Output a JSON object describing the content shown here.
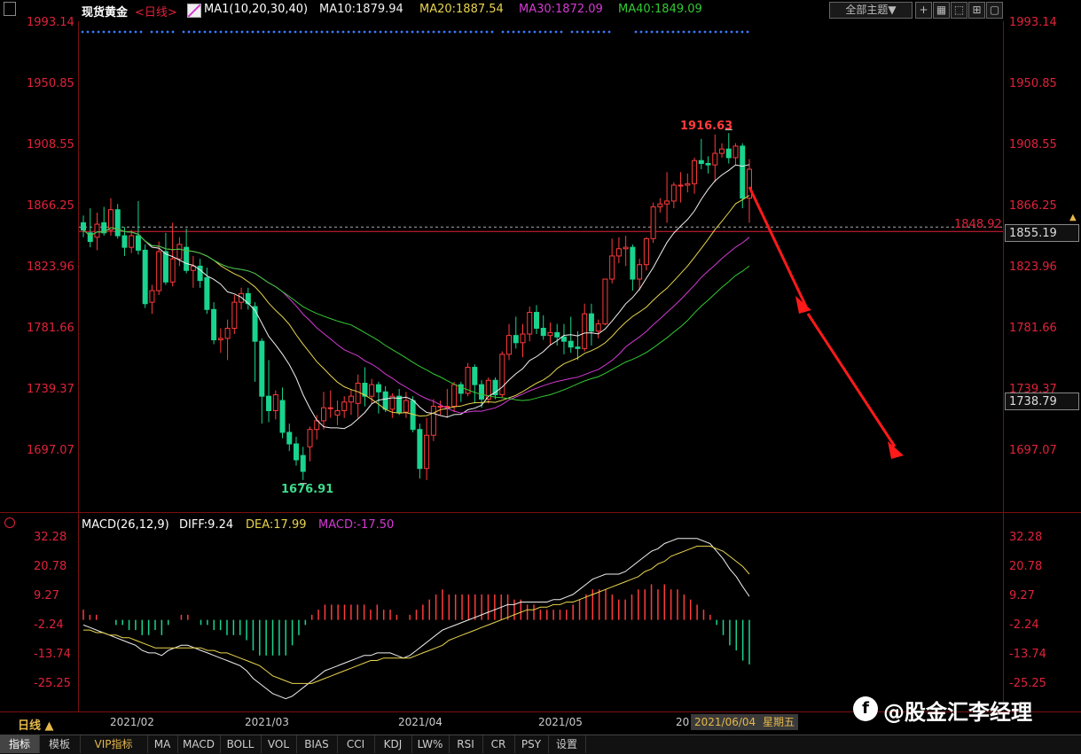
{
  "header": {
    "symbol": "现货黄金",
    "period": "<日线>",
    "ma_label": "MA1(10,20,30,40)",
    "ma10": "MA10:1879.94",
    "ma20": "MA20:1887.54",
    "ma30": "MA30:1872.09",
    "ma40": "MA40:1849.09",
    "theme_button": "全部主题▼"
  },
  "colors": {
    "up": "#ff3b3b",
    "down": "#19d48f",
    "ma10": "#f0f0f0",
    "ma20": "#e8d44d",
    "ma30": "#d43ad4",
    "ma40": "#34c934",
    "axis": "#e0223a",
    "arrow": "#ff1a1a"
  },
  "price_axis": {
    "labels": [
      "1993.14",
      "1950.85",
      "1908.55",
      "1866.25",
      "1823.96",
      "1781.66",
      "1739.37",
      "1697.07"
    ]
  },
  "price_annotations": {
    "high": "1916.63",
    "low": "1676.91",
    "current_line": "1848.92",
    "cursor_price": "1855.19",
    "cursor_price_low": "1738.79"
  },
  "macd": {
    "label": "MACD(26,12,9)",
    "diff": "DIFF:9.24",
    "dea": "DEA:17.99",
    "macd": "MACD:-17.50",
    "axis_labels": [
      "32.28",
      "20.78",
      "9.27",
      "-2.24",
      "-13.74",
      "-25.25"
    ]
  },
  "x_axis": {
    "labels": [
      "2021/02",
      "2021/03",
      "2021/04",
      "2021/05",
      "20"
    ],
    "cursor_date": "2021/06/04",
    "cursor_weekday": "星期五"
  },
  "bottom_tabs": {
    "period": "日线 ▲",
    "items": [
      "指标",
      "模板",
      "VIP指标",
      "MA",
      "MACD",
      "BOLL",
      "VOL",
      "BIAS",
      "CCI",
      "KDJ",
      "LW%",
      "RSI",
      "CR",
      "PSY",
      "设置"
    ]
  },
  "watermark": "@股金汇李经理",
  "chart_data": {
    "type": "candlestick",
    "title": "现货黄金<日线>",
    "ylim": [
      1665,
      2000
    ],
    "yticks": [
      1993.14,
      1950.85,
      1908.55,
      1866.25,
      1823.96,
      1781.66,
      1739.37,
      1697.07
    ],
    "x_range": [
      "2021-01-20",
      "2021-06-04"
    ],
    "candles": [
      {
        "date": "2021-01-20",
        "o": 1855,
        "h": 1860,
        "l": 1845,
        "c": 1850
      },
      {
        "date": "2021-01-21",
        "o": 1848,
        "h": 1865,
        "l": 1838,
        "c": 1842
      },
      {
        "date": "2021-01-22",
        "o": 1845,
        "h": 1862,
        "l": 1836,
        "c": 1854
      },
      {
        "date": "2021-01-25",
        "o": 1855,
        "h": 1866,
        "l": 1846,
        "c": 1848
      },
      {
        "date": "2021-01-26",
        "o": 1850,
        "h": 1872,
        "l": 1846,
        "c": 1864
      },
      {
        "date": "2021-01-27",
        "o": 1864,
        "h": 1868,
        "l": 1844,
        "c": 1846
      },
      {
        "date": "2021-01-28",
        "o": 1846,
        "h": 1852,
        "l": 1832,
        "c": 1838
      },
      {
        "date": "2021-01-29",
        "o": 1838,
        "h": 1850,
        "l": 1834,
        "c": 1846
      },
      {
        "date": "2021-02-01",
        "o": 1846,
        "h": 1870,
        "l": 1833,
        "c": 1836
      },
      {
        "date": "2021-02-02",
        "o": 1836,
        "h": 1840,
        "l": 1796,
        "c": 1799
      },
      {
        "date": "2021-02-03",
        "o": 1800,
        "h": 1812,
        "l": 1792,
        "c": 1808
      },
      {
        "date": "2021-02-04",
        "o": 1808,
        "h": 1842,
        "l": 1805,
        "c": 1835
      },
      {
        "date": "2021-02-05",
        "o": 1835,
        "h": 1848,
        "l": 1812,
        "c": 1814
      },
      {
        "date": "2021-02-08",
        "o": 1814,
        "h": 1855,
        "l": 1811,
        "c": 1830
      },
      {
        "date": "2021-02-09",
        "o": 1830,
        "h": 1845,
        "l": 1825,
        "c": 1840
      },
      {
        "date": "2021-02-10",
        "o": 1838,
        "h": 1851,
        "l": 1820,
        "c": 1822
      },
      {
        "date": "2021-02-11",
        "o": 1822,
        "h": 1832,
        "l": 1810,
        "c": 1825
      },
      {
        "date": "2021-02-12",
        "o": 1825,
        "h": 1830,
        "l": 1810,
        "c": 1815
      },
      {
        "date": "2021-02-15",
        "o": 1817,
        "h": 1824,
        "l": 1792,
        "c": 1795
      },
      {
        "date": "2021-02-16",
        "o": 1795,
        "h": 1800,
        "l": 1771,
        "c": 1774
      },
      {
        "date": "2021-02-17",
        "o": 1774,
        "h": 1782,
        "l": 1765,
        "c": 1775
      },
      {
        "date": "2021-02-18",
        "o": 1775,
        "h": 1788,
        "l": 1760,
        "c": 1782
      },
      {
        "date": "2021-02-19",
        "o": 1782,
        "h": 1805,
        "l": 1778,
        "c": 1800
      },
      {
        "date": "2021-02-22",
        "o": 1800,
        "h": 1810,
        "l": 1795,
        "c": 1806
      },
      {
        "date": "2021-02-23",
        "o": 1806,
        "h": 1810,
        "l": 1795,
        "c": 1799
      },
      {
        "date": "2021-02-24",
        "o": 1797,
        "h": 1800,
        "l": 1745,
        "c": 1773
      },
      {
        "date": "2021-02-25",
        "o": 1773,
        "h": 1775,
        "l": 1716,
        "c": 1735
      },
      {
        "date": "2021-02-26",
        "o": 1735,
        "h": 1760,
        "l": 1717,
        "c": 1725
      },
      {
        "date": "2021-03-01",
        "o": 1725,
        "h": 1739,
        "l": 1719,
        "c": 1736
      },
      {
        "date": "2021-03-02",
        "o": 1732,
        "h": 1741,
        "l": 1706,
        "c": 1710
      },
      {
        "date": "2021-03-03",
        "o": 1710,
        "h": 1716,
        "l": 1697,
        "c": 1702
      },
      {
        "date": "2021-03-04",
        "o": 1702,
        "h": 1707,
        "l": 1687,
        "c": 1691
      },
      {
        "date": "2021-03-05",
        "o": 1694,
        "h": 1700,
        "l": 1677,
        "c": 1683
      },
      {
        "date": "2021-03-08",
        "o": 1700,
        "h": 1714,
        "l": 1690,
        "c": 1712
      },
      {
        "date": "2021-03-09",
        "o": 1712,
        "h": 1722,
        "l": 1705,
        "c": 1718
      },
      {
        "date": "2021-03-10",
        "o": 1718,
        "h": 1738,
        "l": 1712,
        "c": 1727
      },
      {
        "date": "2021-03-11",
        "o": 1727,
        "h": 1739,
        "l": 1720,
        "c": 1727
      },
      {
        "date": "2021-03-12",
        "o": 1722,
        "h": 1732,
        "l": 1715,
        "c": 1725
      },
      {
        "date": "2021-03-15",
        "o": 1725,
        "h": 1735,
        "l": 1720,
        "c": 1731
      },
      {
        "date": "2021-03-16",
        "o": 1731,
        "h": 1740,
        "l": 1722,
        "c": 1735
      },
      {
        "date": "2021-03-17",
        "o": 1730,
        "h": 1750,
        "l": 1720,
        "c": 1744
      },
      {
        "date": "2021-03-18",
        "o": 1744,
        "h": 1755,
        "l": 1728,
        "c": 1735
      },
      {
        "date": "2021-03-19",
        "o": 1735,
        "h": 1747,
        "l": 1730,
        "c": 1743
      },
      {
        "date": "2021-03-22",
        "o": 1743,
        "h": 1745,
        "l": 1723,
        "c": 1738
      },
      {
        "date": "2021-03-23",
        "o": 1738,
        "h": 1742,
        "l": 1724,
        "c": 1726
      },
      {
        "date": "2021-03-24",
        "o": 1726,
        "h": 1737,
        "l": 1720,
        "c": 1735
      },
      {
        "date": "2021-03-25",
        "o": 1735,
        "h": 1740,
        "l": 1722,
        "c": 1724
      },
      {
        "date": "2021-03-26",
        "o": 1724,
        "h": 1738,
        "l": 1720,
        "c": 1732
      },
      {
        "date": "2021-03-29",
        "o": 1732,
        "h": 1735,
        "l": 1710,
        "c": 1712
      },
      {
        "date": "2021-03-30",
        "o": 1712,
        "h": 1716,
        "l": 1678,
        "c": 1685
      },
      {
        "date": "2021-03-31",
        "o": 1685,
        "h": 1720,
        "l": 1677,
        "c": 1708
      },
      {
        "date": "2021-04-01",
        "o": 1708,
        "h": 1733,
        "l": 1704,
        "c": 1728
      },
      {
        "date": "2021-04-02",
        "o": 1728,
        "h": 1732,
        "l": 1722,
        "c": 1728
      },
      {
        "date": "2021-04-05",
        "o": 1728,
        "h": 1740,
        "l": 1720,
        "c": 1728
      },
      {
        "date": "2021-04-06",
        "o": 1728,
        "h": 1745,
        "l": 1724,
        "c": 1743
      },
      {
        "date": "2021-04-07",
        "o": 1743,
        "h": 1745,
        "l": 1731,
        "c": 1737
      },
      {
        "date": "2021-04-08",
        "o": 1737,
        "h": 1758,
        "l": 1735,
        "c": 1755
      },
      {
        "date": "2021-04-09",
        "o": 1755,
        "h": 1757,
        "l": 1730,
        "c": 1743
      },
      {
        "date": "2021-04-12",
        "o": 1743,
        "h": 1746,
        "l": 1727,
        "c": 1733
      },
      {
        "date": "2021-04-13",
        "o": 1733,
        "h": 1748,
        "l": 1730,
        "c": 1746
      },
      {
        "date": "2021-04-14",
        "o": 1746,
        "h": 1748,
        "l": 1733,
        "c": 1736
      },
      {
        "date": "2021-04-15",
        "o": 1736,
        "h": 1766,
        "l": 1734,
        "c": 1764
      },
      {
        "date": "2021-04-16",
        "o": 1764,
        "h": 1785,
        "l": 1760,
        "c": 1777
      },
      {
        "date": "2021-04-19",
        "o": 1777,
        "h": 1790,
        "l": 1768,
        "c": 1772
      },
      {
        "date": "2021-04-20",
        "o": 1772,
        "h": 1785,
        "l": 1762,
        "c": 1778
      },
      {
        "date": "2021-04-21",
        "o": 1778,
        "h": 1797,
        "l": 1773,
        "c": 1793
      },
      {
        "date": "2021-04-22",
        "o": 1793,
        "h": 1798,
        "l": 1778,
        "c": 1782
      },
      {
        "date": "2021-04-23",
        "o": 1782,
        "h": 1791,
        "l": 1774,
        "c": 1777
      },
      {
        "date": "2021-04-26",
        "o": 1777,
        "h": 1786,
        "l": 1770,
        "c": 1779
      },
      {
        "date": "2021-04-27",
        "o": 1779,
        "h": 1785,
        "l": 1770,
        "c": 1776
      },
      {
        "date": "2021-04-28",
        "o": 1776,
        "h": 1785,
        "l": 1764,
        "c": 1773
      },
      {
        "date": "2021-04-29",
        "o": 1773,
        "h": 1790,
        "l": 1765,
        "c": 1769
      },
      {
        "date": "2021-04-30",
        "o": 1769,
        "h": 1780,
        "l": 1760,
        "c": 1768
      },
      {
        "date": "2021-05-03",
        "o": 1768,
        "h": 1799,
        "l": 1766,
        "c": 1792
      },
      {
        "date": "2021-05-04",
        "o": 1792,
        "h": 1799,
        "l": 1770,
        "c": 1780
      },
      {
        "date": "2021-05-05",
        "o": 1780,
        "h": 1788,
        "l": 1775,
        "c": 1785
      },
      {
        "date": "2021-05-06",
        "o": 1785,
        "h": 1816,
        "l": 1784,
        "c": 1816
      },
      {
        "date": "2021-05-07",
        "o": 1816,
        "h": 1844,
        "l": 1813,
        "c": 1832
      },
      {
        "date": "2021-05-10",
        "o": 1832,
        "h": 1845,
        "l": 1827,
        "c": 1837
      },
      {
        "date": "2021-05-11",
        "o": 1837,
        "h": 1846,
        "l": 1825,
        "c": 1838
      },
      {
        "date": "2021-05-12",
        "o": 1838,
        "h": 1840,
        "l": 1808,
        "c": 1816
      },
      {
        "date": "2021-05-13",
        "o": 1816,
        "h": 1830,
        "l": 1808,
        "c": 1826
      },
      {
        "date": "2021-05-14",
        "o": 1826,
        "h": 1845,
        "l": 1822,
        "c": 1844
      },
      {
        "date": "2021-05-17",
        "o": 1844,
        "h": 1869,
        "l": 1841,
        "c": 1866
      },
      {
        "date": "2021-05-18",
        "o": 1866,
        "h": 1872,
        "l": 1862,
        "c": 1868
      },
      {
        "date": "2021-05-19",
        "o": 1868,
        "h": 1890,
        "l": 1855,
        "c": 1870
      },
      {
        "date": "2021-05-20",
        "o": 1870,
        "h": 1883,
        "l": 1865,
        "c": 1881
      },
      {
        "date": "2021-05-21",
        "o": 1881,
        "h": 1890,
        "l": 1869,
        "c": 1881
      },
      {
        "date": "2021-05-24",
        "o": 1881,
        "h": 1889,
        "l": 1876,
        "c": 1882
      },
      {
        "date": "2021-05-25",
        "o": 1882,
        "h": 1900,
        "l": 1875,
        "c": 1898
      },
      {
        "date": "2021-05-26",
        "o": 1898,
        "h": 1913,
        "l": 1892,
        "c": 1896
      },
      {
        "date": "2021-05-27",
        "o": 1896,
        "h": 1901,
        "l": 1889,
        "c": 1895
      },
      {
        "date": "2021-05-28",
        "o": 1895,
        "h": 1916,
        "l": 1883,
        "c": 1903
      },
      {
        "date": "2021-05-31",
        "o": 1903,
        "h": 1910,
        "l": 1900,
        "c": 1906
      },
      {
        "date": "2021-06-01",
        "o": 1906,
        "h": 1917,
        "l": 1896,
        "c": 1900
      },
      {
        "date": "2021-06-02",
        "o": 1900,
        "h": 1910,
        "l": 1895,
        "c": 1908
      },
      {
        "date": "2021-06-03",
        "o": 1908,
        "h": 1910,
        "l": 1865,
        "c": 1872
      },
      {
        "date": "2021-06-04",
        "o": 1872,
        "h": 1899,
        "l": 1855,
        "c": 1892
      }
    ],
    "ma_series": [
      {
        "name": "MA10",
        "color": "#f0f0f0",
        "period": 10
      },
      {
        "name": "MA20",
        "color": "#e8d44d",
        "period": 20
      },
      {
        "name": "MA30",
        "color": "#d43ad4",
        "period": 30
      },
      {
        "name": "MA40",
        "color": "#34c934",
        "period": 40
      }
    ],
    "macd_panel": {
      "ylim": [
        -30,
        36
      ],
      "diff": [
        -2,
        -3,
        -4,
        -5,
        -6,
        -7,
        -8,
        -9,
        -10,
        -12,
        -13,
        -13,
        -14,
        -12,
        -11,
        -10,
        -10,
        -11,
        -12,
        -13,
        -14,
        -15,
        -16,
        -17,
        -18,
        -20,
        -23,
        -25,
        -27,
        -29,
        -30,
        -31,
        -30,
        -28,
        -26,
        -24,
        -22,
        -20,
        -19,
        -18,
        -17,
        -16,
        -15,
        -14,
        -14,
        -13,
        -13,
        -13,
        -14,
        -15,
        -14,
        -12,
        -10,
        -8,
        -6,
        -4,
        -3,
        -2,
        -1,
        0,
        1,
        2,
        3,
        4,
        5,
        6,
        6,
        7,
        7,
        7,
        7,
        7,
        8,
        8,
        9,
        10,
        12,
        14,
        16,
        17,
        18,
        18,
        18,
        19,
        21,
        23,
        25,
        27,
        28,
        30,
        31,
        32,
        32,
        32,
        32,
        31,
        30,
        27,
        24,
        20,
        17,
        13,
        9.24
      ],
      "dea": [
        -4,
        -4,
        -5,
        -5,
        -6,
        -6,
        -7,
        -7,
        -8,
        -9,
        -10,
        -11,
        -11,
        -11,
        -11,
        -11,
        -11,
        -11,
        -11,
        -12,
        -12,
        -13,
        -13,
        -14,
        -15,
        -16,
        -17,
        -18,
        -20,
        -22,
        -23,
        -24,
        -25,
        -25,
        -25,
        -25,
        -24,
        -23,
        -22,
        -21,
        -20,
        -19,
        -18,
        -17,
        -16,
        -16,
        -15,
        -15,
        -15,
        -15,
        -15,
        -14,
        -13,
        -12,
        -11,
        -10,
        -8,
        -7,
        -6,
        -5,
        -4,
        -3,
        -2,
        -1,
        0,
        1,
        2,
        3,
        4,
        4,
        5,
        5,
        6,
        6,
        7,
        7,
        8,
        9,
        10,
        11,
        12,
        13,
        14,
        15,
        16,
        17,
        19,
        20,
        22,
        23,
        25,
        26,
        27,
        28,
        29,
        29,
        29,
        28,
        27,
        25,
        23,
        21,
        17.99
      ]
    }
  }
}
